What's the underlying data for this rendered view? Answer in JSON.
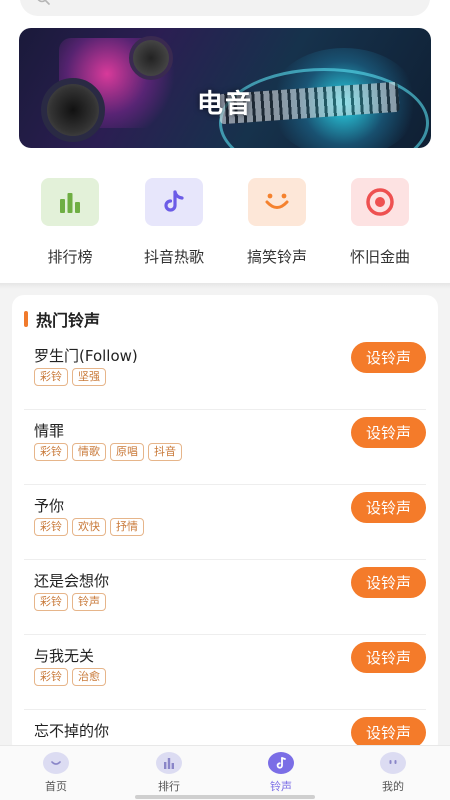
{
  "search": {
    "placeholder": ""
  },
  "banner": {
    "title": "电音"
  },
  "categories": [
    {
      "label": "排行榜",
      "icon": "chart-bars-icon",
      "bg": "#e3f1d9",
      "color": "#6fae43"
    },
    {
      "label": "抖音热歌",
      "icon": "tiktok-note-icon",
      "bg": "#e7e6fb",
      "color": "#6c5ce7"
    },
    {
      "label": "搞笑铃声",
      "icon": "smile-icon",
      "bg": "#fde7d8",
      "color": "#f5822e"
    },
    {
      "label": "怀旧金曲",
      "icon": "target-icon",
      "bg": "#fde2e2",
      "color": "#ee5151"
    }
  ],
  "hot_section": {
    "title": "热门铃声"
  },
  "ringtones": [
    {
      "name": "罗生门(Follow)",
      "tags": [
        "彩铃",
        "坚强"
      ],
      "button": "设铃声"
    },
    {
      "name": "情罪",
      "tags": [
        "彩铃",
        "情歌",
        "原唱",
        "抖音"
      ],
      "button": "设铃声"
    },
    {
      "name": "予你",
      "tags": [
        "彩铃",
        "欢快",
        "抒情"
      ],
      "button": "设铃声"
    },
    {
      "name": "还是会想你",
      "tags": [
        "彩铃",
        "铃声"
      ],
      "button": "设铃声"
    },
    {
      "name": "与我无关",
      "tags": [
        "彩铃",
        "治愈"
      ],
      "button": "设铃声"
    },
    {
      "name": "忘不掉的你",
      "tags": [],
      "button": "设铃声"
    }
  ],
  "tabs": [
    {
      "label": "首页",
      "icon": "home-face-icon",
      "active": false
    },
    {
      "label": "排行",
      "icon": "rank-bars-icon",
      "active": false
    },
    {
      "label": "铃声",
      "icon": "music-note-icon",
      "active": true
    },
    {
      "label": "我的",
      "icon": "profile-face-icon",
      "active": false
    }
  ],
  "colors": {
    "accent": "#f47b2a",
    "tab_active": "#7b6ee6",
    "tag_text": "#c97a3a"
  }
}
